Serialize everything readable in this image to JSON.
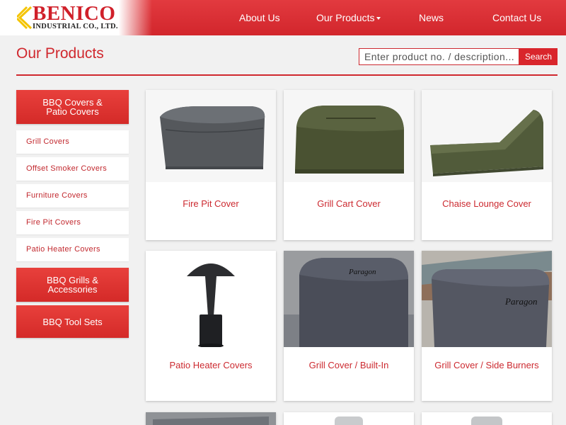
{
  "brand": {
    "name": "BENICO",
    "subtitle": "INDUSTRIAL CO., LTD.",
    "color": "#d0202a"
  },
  "nav": {
    "about": "About Us",
    "products": "Our Products",
    "news": "News",
    "contact": "Contact Us"
  },
  "page": {
    "title": "Our Products"
  },
  "search": {
    "placeholder": "Enter product no. / description...",
    "button": "Search"
  },
  "sidebar": {
    "categories": [
      {
        "label_lines": [
          "BBQ Covers &",
          "Patio Covers"
        ],
        "items": [
          "Grill Covers",
          "Offset Smoker Covers",
          "Furniture Covers",
          "Fire Pit Covers",
          "Patio Heater Covers"
        ]
      },
      {
        "label_lines": [
          "BBQ Grills &",
          "Accessories"
        ]
      },
      {
        "label_lines": [
          "BBQ Tool Sets"
        ]
      }
    ]
  },
  "products": [
    {
      "name": "Fire Pit Cover",
      "image": "fire-pit-cover-image",
      "cover_color": "#55585c"
    },
    {
      "name": "Grill Cart Cover",
      "image": "grill-cart-cover-image",
      "cover_color": "#4a5232"
    },
    {
      "name": "Chaise Lounge Cover",
      "image": "chaise-lounge-cover-image",
      "cover_color": "#515b3a"
    },
    {
      "name": "Patio Heater Covers",
      "image": "patio-heater-cover-image",
      "cover_color": "#2c2d30"
    },
    {
      "name": "Grill Cover / Built-In",
      "image": "built-in-grill-cover-image",
      "cover_color": "#4a4d58",
      "brand_text": "Paragon"
    },
    {
      "name": "Grill Cover / Side Burners",
      "image": "side-burner-grill-cover-image",
      "cover_color": "#545762",
      "brand_text": "Paragon"
    },
    {
      "name": "",
      "image": "product-image"
    },
    {
      "name": "",
      "image": "product-image"
    },
    {
      "name": "",
      "image": "product-image"
    }
  ],
  "colors": {
    "accent": "#d9262c",
    "link": "#cc2a30",
    "background": "#f1f1f1"
  }
}
